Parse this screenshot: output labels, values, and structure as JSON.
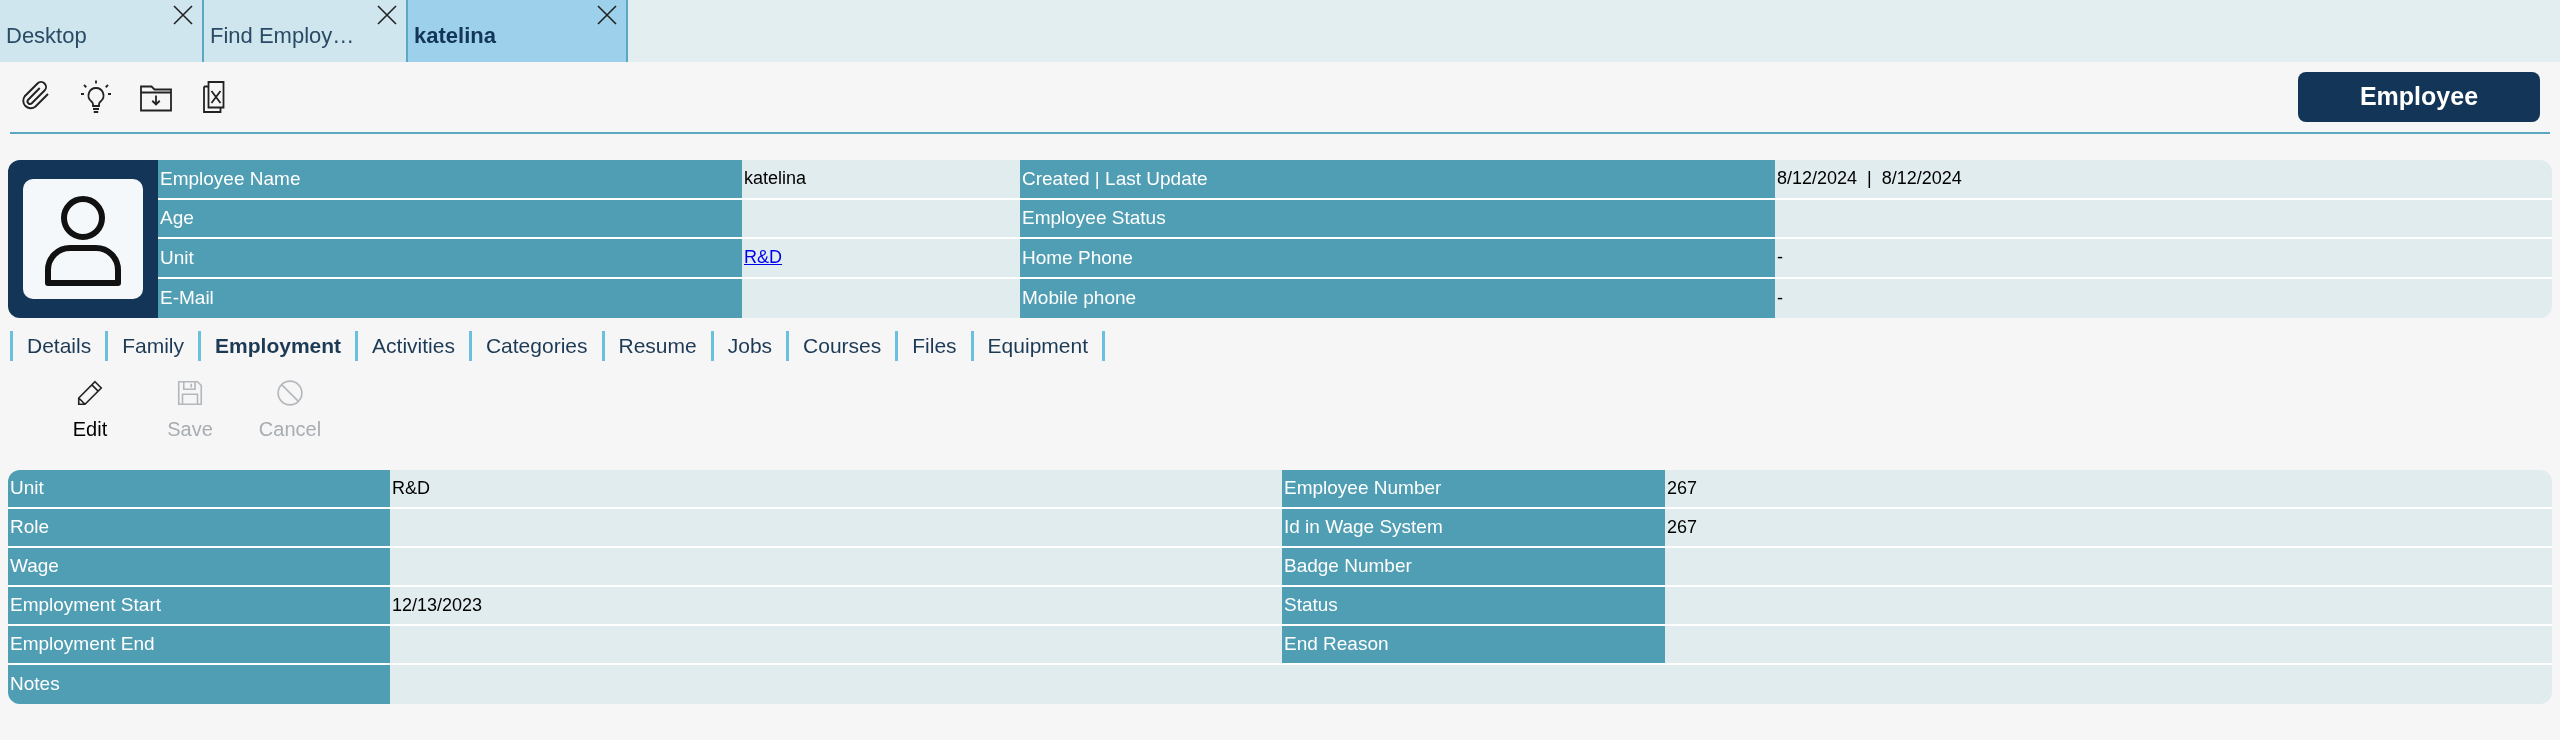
{
  "open_tabs": [
    {
      "label": "Desktop",
      "selected": false
    },
    {
      "label": "Find Employ…",
      "selected": false
    },
    {
      "label": "katelina",
      "selected": true
    }
  ],
  "toolbar": {
    "button": "Employee"
  },
  "header": {
    "left": [
      {
        "label": "Employee Name",
        "value": "katelina",
        "kind": "text"
      },
      {
        "label": "Age"
      },
      {
        "label": "Unit",
        "value": "R&D",
        "kind": "link"
      },
      {
        "label": "E-Mail"
      }
    ],
    "right": [
      {
        "label": "Created | Last Update",
        "value": "8/12/2024  |  8/12/2024",
        "kind": "text"
      },
      {
        "label": "Employee Status"
      },
      {
        "label": "Home Phone",
        "value": "-",
        "kind": "text"
      },
      {
        "label": "Mobile phone",
        "value": "-",
        "kind": "text"
      }
    ]
  },
  "section_tabs": [
    {
      "label": "Details",
      "selected": false
    },
    {
      "label": "Family",
      "selected": false
    },
    {
      "label": "Employment",
      "selected": true
    },
    {
      "label": "Activities",
      "selected": false
    },
    {
      "label": "Categories",
      "selected": false
    },
    {
      "label": "Resume",
      "selected": false
    },
    {
      "label": "Jobs",
      "selected": false
    },
    {
      "label": "Courses",
      "selected": false
    },
    {
      "label": "Files",
      "selected": false
    },
    {
      "label": "Equipment",
      "selected": false
    }
  ],
  "actions": [
    {
      "label": "Edit",
      "kind": "edit",
      "disabled": false
    },
    {
      "label": "Save",
      "kind": "save",
      "disabled": true
    },
    {
      "label": "Cancel",
      "kind": "cancel",
      "disabled": true
    }
  ],
  "employment": {
    "left": [
      {
        "label": "Unit",
        "value": "R&D"
      },
      {
        "label": "Role"
      },
      {
        "label": "Wage"
      },
      {
        "label": "Employment Start",
        "value": "12/13/2023"
      },
      {
        "label": "Employment End"
      },
      {
        "label": "Notes"
      }
    ],
    "right": [
      {
        "label": "Employee Number",
        "value": "267"
      },
      {
        "label": "Id in Wage System",
        "value": "267"
      },
      {
        "label": "Badge Number"
      },
      {
        "label": "Status"
      },
      {
        "label": "End Reason"
      }
    ]
  }
}
